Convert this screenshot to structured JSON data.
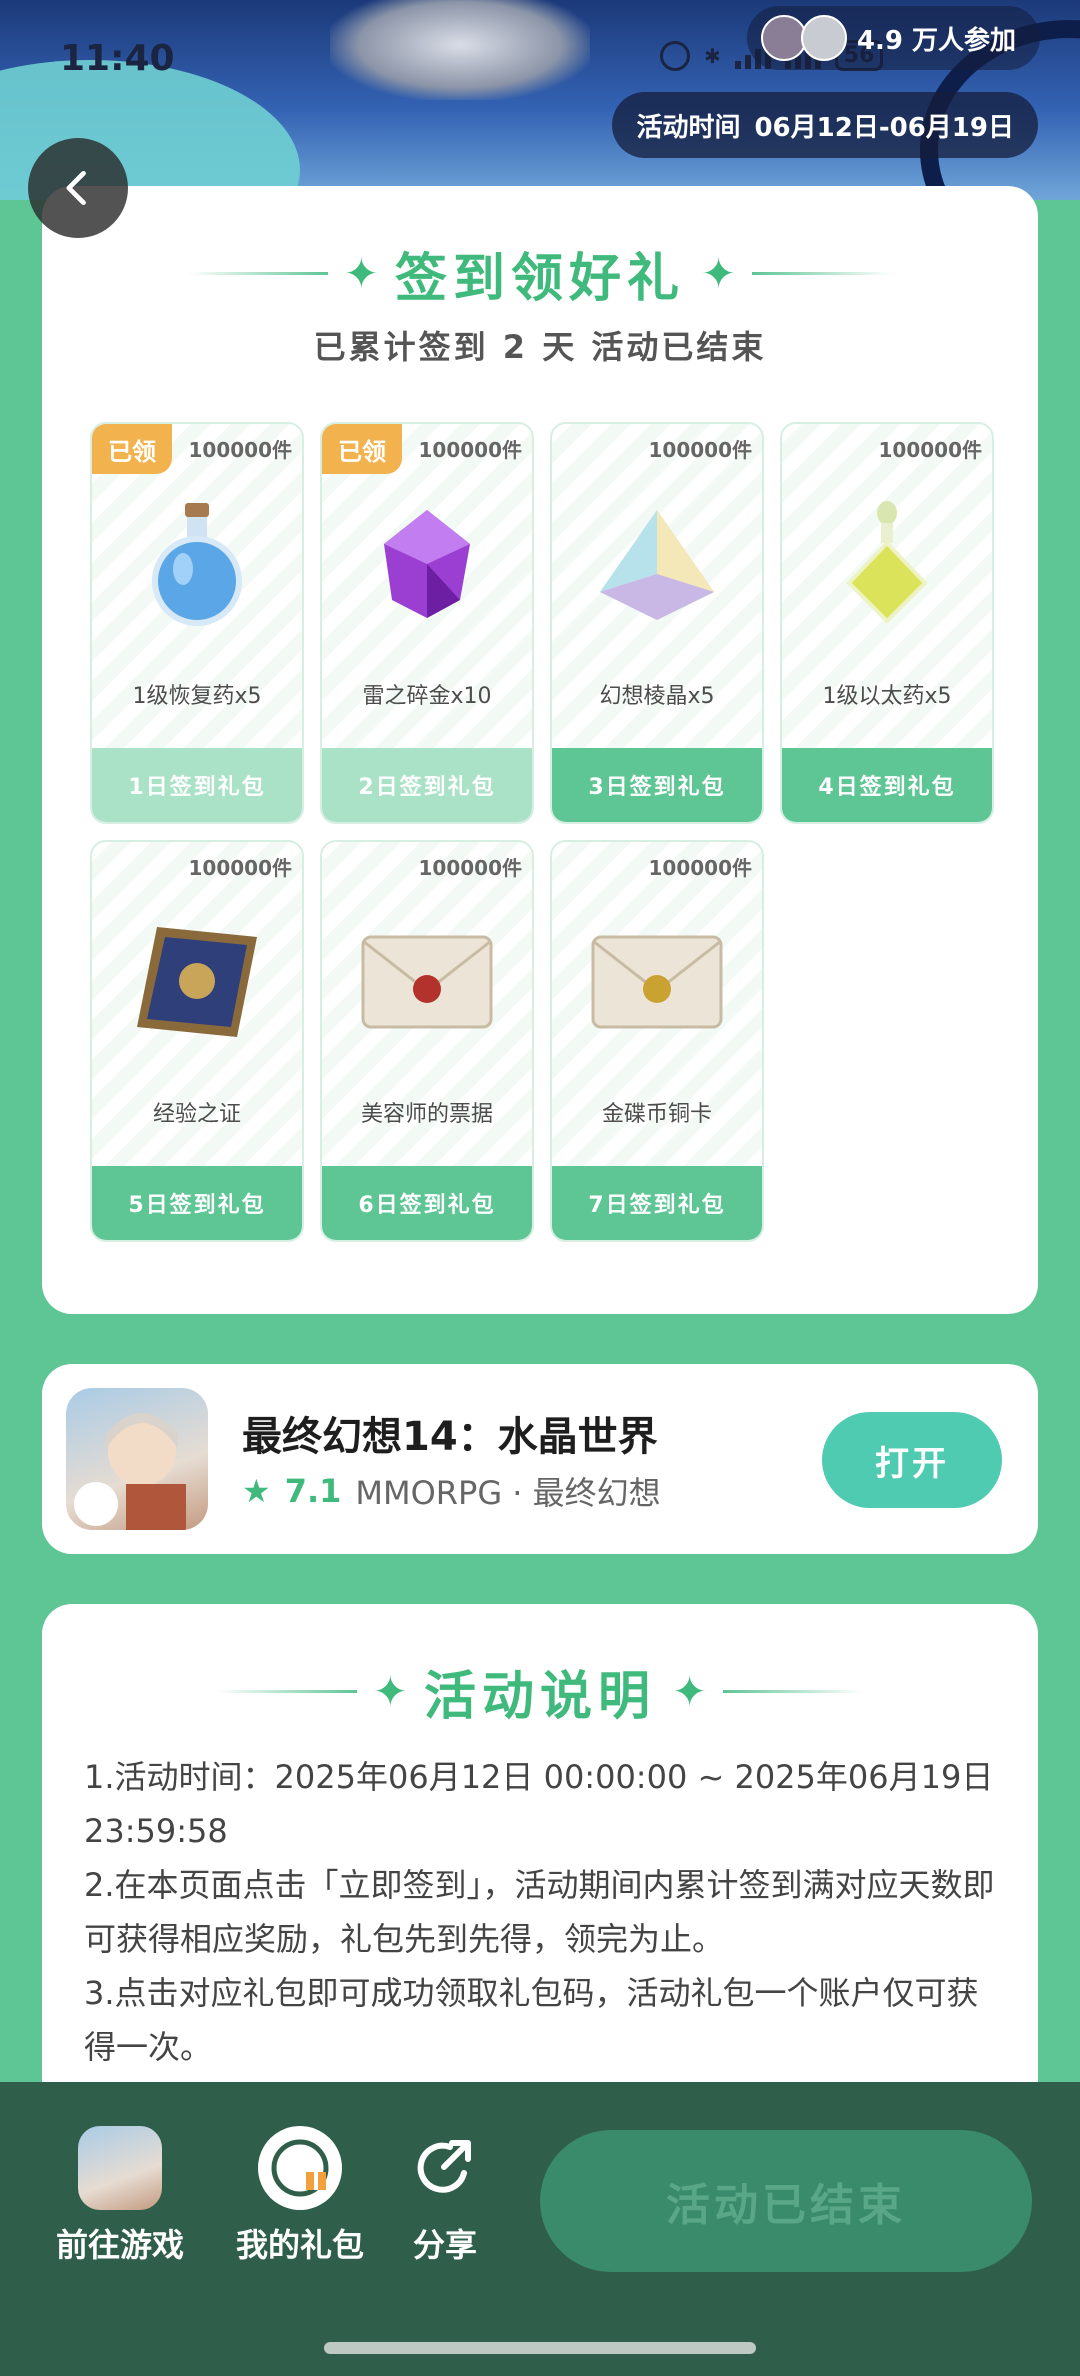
{
  "status": {
    "time": "11:40",
    "battery": "56"
  },
  "banner": {
    "participants": "4.9 万人参加",
    "event_time_label": "活动时间",
    "event_time_value": "06月12日-06月19日"
  },
  "signin": {
    "title": "签到领好礼",
    "subtitle": "已累计签到 2 天   活动已结束",
    "rewards": [
      {
        "name": "1级恢复药x5",
        "stock": "100000件",
        "day": "1日签到礼包",
        "badge": "已领"
      },
      {
        "name": "雷之碎金x10",
        "stock": "100000件",
        "day": "2日签到礼包",
        "badge": "已领"
      },
      {
        "name": "幻想棱晶x5",
        "stock": "100000件",
        "day": "3日签到礼包"
      },
      {
        "name": "1级以太药x5",
        "stock": "100000件",
        "day": "4日签到礼包"
      },
      {
        "name": "经验之证",
        "stock": "100000件",
        "day": "5日签到礼包"
      },
      {
        "name": "美容师的票据",
        "stock": "100000件",
        "day": "6日签到礼包"
      },
      {
        "name": "金碟币铜卡",
        "stock": "100000件",
        "day": "7日签到礼包"
      }
    ]
  },
  "game": {
    "name": "最终幻想14：水晶世界",
    "rating": "7.1",
    "genre": "MMORPG · 最终幻想",
    "open_label": "打开"
  },
  "rules": {
    "title": "活动说明",
    "lines": [
      "1.活动时间：2025年06月12日 00:00:00 ~ 2025年06月19日 23:59:58",
      "2.在本页面点击「立即签到」，活动期间内累计签到满对应天数即可获得相应奖励，礼包先到先得，领完为止。",
      "3.点击对应礼包即可成功领取礼包码，活动礼包一个账户仅可获得一次。"
    ]
  },
  "bottom": {
    "goto_game": "前往游戏",
    "my_gifts": "我的礼包",
    "share": "分享",
    "end_label": "活动已结束"
  },
  "colors": {
    "brand_green": "#5ec594",
    "accent_title": "#3fba7c",
    "claimed_badge": "#f2b24d"
  }
}
